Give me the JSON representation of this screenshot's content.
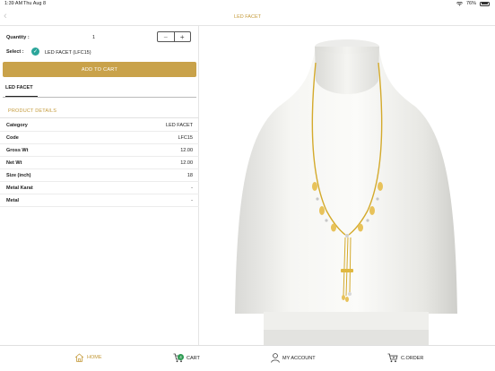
{
  "status_bar": {
    "time": "1:39 AM",
    "date": "Thu Aug 8",
    "battery": "76%"
  },
  "nav": {
    "title": "LED FACET",
    "back_icon": "chevron-left-icon"
  },
  "quantity": {
    "label": "Quantity :",
    "value": "1",
    "minus": "−",
    "plus": "+"
  },
  "select": {
    "label": "Select :",
    "value": "LED FACET (LFC15)"
  },
  "add_to_cart": "ADD TO CART",
  "tab": "LED FACET",
  "details_title": "PRODUCT DETAILS",
  "details": [
    {
      "key": "Category",
      "value": "LED FACET"
    },
    {
      "key": "Code",
      "value": "LFC15"
    },
    {
      "key": "Gross Wt",
      "value": "12.00"
    },
    {
      "key": "Net Wt",
      "value": "12.00"
    },
    {
      "key": "Size (inch)",
      "value": "18"
    },
    {
      "key": "Metal Karat",
      "value": "-"
    },
    {
      "key": "Metal",
      "value": "-"
    }
  ],
  "tabbar": {
    "home": "HOME",
    "cart": "CART",
    "cart_count": "4",
    "account": "MY ACCOUNT",
    "orders": "C.ORDER"
  },
  "colors": {
    "accent": "#c9a24a",
    "check": "#2aa59a",
    "badge": "#2e9b53"
  }
}
